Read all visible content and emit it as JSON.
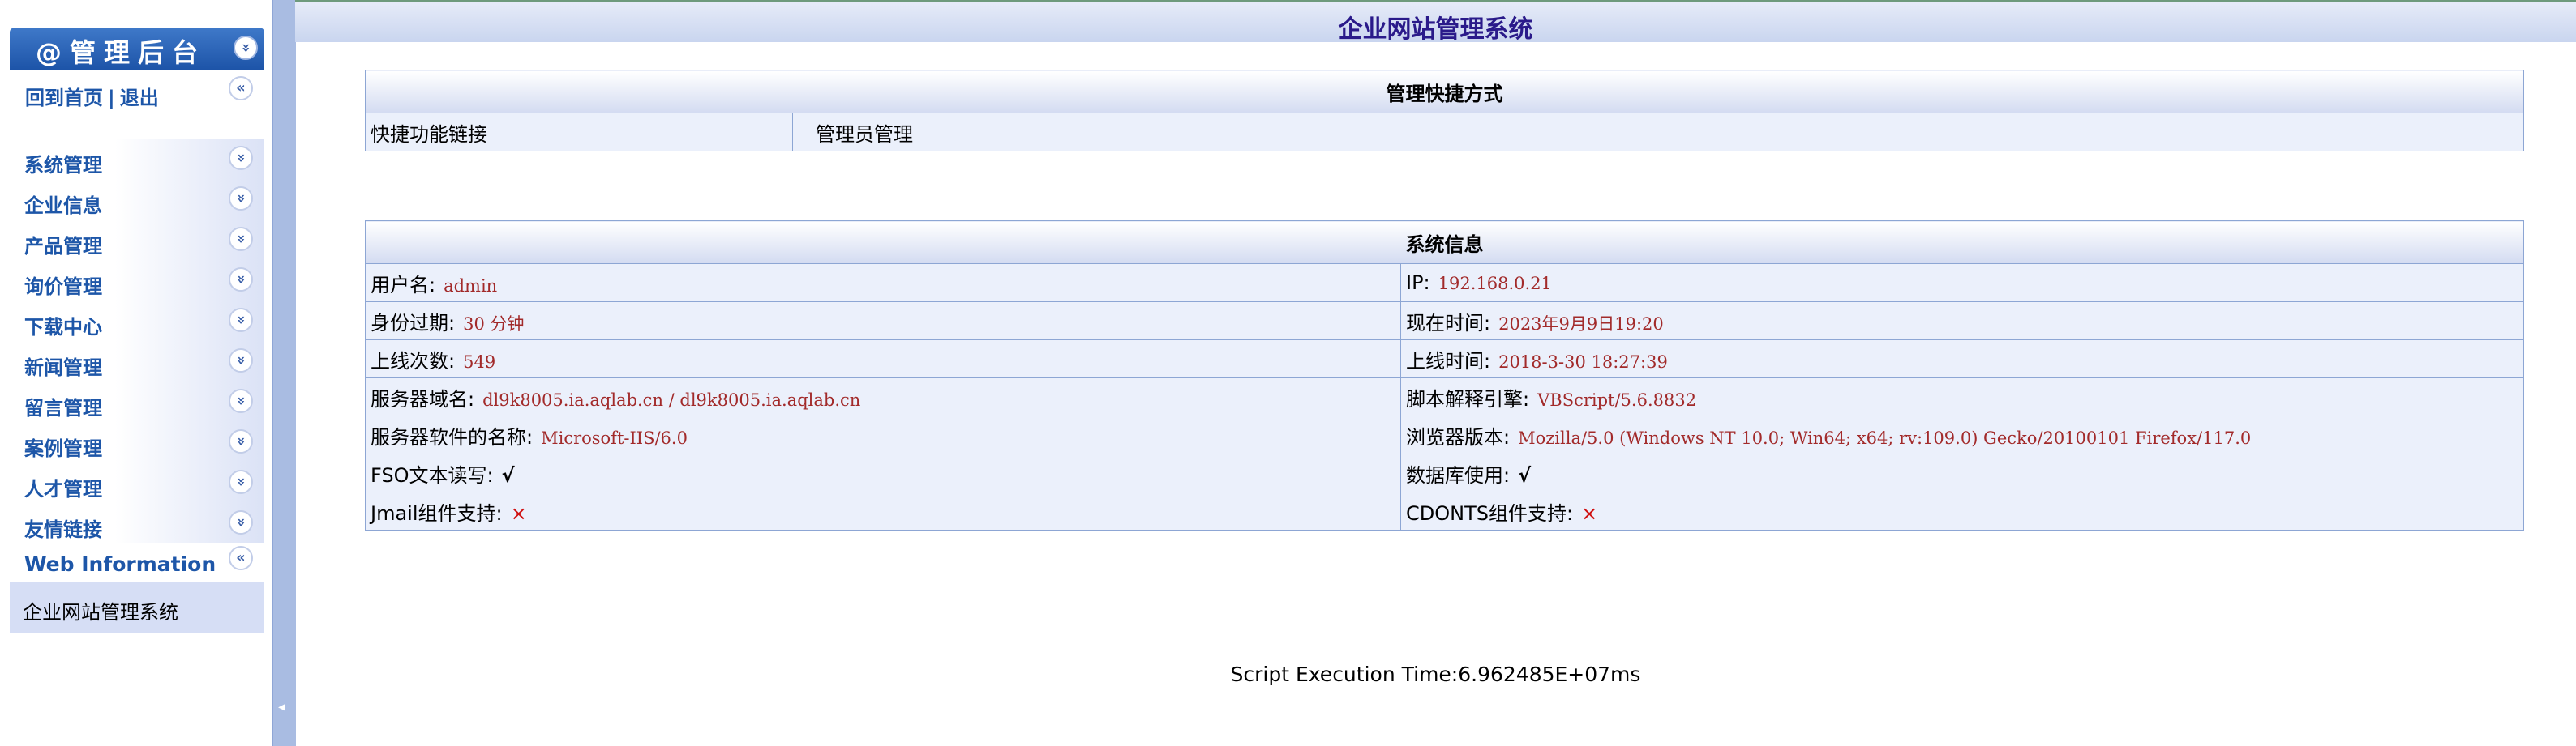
{
  "sidebar": {
    "header_title": "@管理后台",
    "header_icon": "chevron-down-icon",
    "home_link": "回到首页",
    "separator": "|",
    "logout_link": "退出",
    "items": [
      {
        "label": "系统管理"
      },
      {
        "label": "企业信息"
      },
      {
        "label": "产品管理"
      },
      {
        "label": "询价管理"
      },
      {
        "label": "下载中心"
      },
      {
        "label": "新闻管理"
      },
      {
        "label": "留言管理"
      },
      {
        "label": "案例管理"
      },
      {
        "label": "人才管理"
      },
      {
        "label": "友情链接"
      }
    ],
    "web_info_label": "Web Information",
    "web_info_text": "企业网站管理系统",
    "chevron_down": "»",
    "chevron_up": "«"
  },
  "splitter": {
    "handle": "◂"
  },
  "header": {
    "title": "企业网站管理系统"
  },
  "quick": {
    "title": "管理快捷方式",
    "row_label": "快捷功能链接",
    "row_link": "管理员管理"
  },
  "sysinfo": {
    "title": "系统信息",
    "rows": [
      {
        "l_label": "用户名:",
        "l_value": "admin",
        "r_label": "IP:",
        "r_value": "192.168.0.21"
      },
      {
        "l_label": "身份过期:",
        "l_value": "30 分钟",
        "r_label": "现在时间:",
        "r_value": "2023年9月9日19:20"
      },
      {
        "l_label": "上线次数:",
        "l_value": "549",
        "r_label": "上线时间:",
        "r_value": "2018-3-30 18:27:39"
      },
      {
        "l_label": "服务器域名:",
        "l_value": "dl9k8005.ia.aqlab.cn / dl9k8005.ia.aqlab.cn",
        "r_label": "脚本解释引擎:",
        "r_value": "VBScript/5.6.8832"
      },
      {
        "l_label": "服务器软件的名称:",
        "l_value": "Microsoft-IIS/6.0",
        "r_label": "浏览器版本:",
        "r_value": "Mozilla/5.0 (Windows NT 10.0; Win64; x64; rv:109.0) Gecko/20100101 Firefox/117.0"
      },
      {
        "l_label": "FSO文本读写:",
        "l_value": "√",
        "r_label": "数据库使用:",
        "r_value": "√"
      },
      {
        "l_label": "Jmail组件支持:",
        "l_value": "×",
        "r_label": "CDONTS组件支持:",
        "r_value": "×"
      }
    ]
  },
  "footer": {
    "text": "Script Execution Time:6.962485E+07ms"
  },
  "colors": {
    "accent": "#1d56a8",
    "value_red": "#a22a2a",
    "cross_red": "#d01010"
  }
}
